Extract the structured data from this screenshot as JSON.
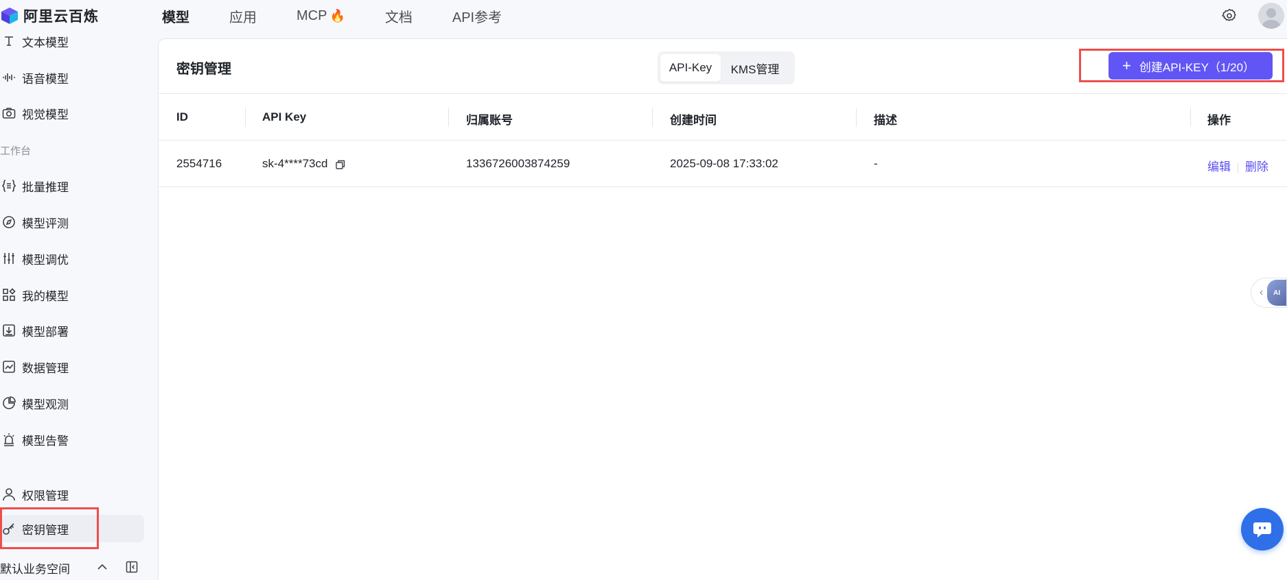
{
  "brand": {
    "name": "阿里云百炼"
  },
  "topnav": {
    "items": [
      {
        "label": "模型",
        "active": true
      },
      {
        "label": "应用"
      },
      {
        "label": "MCP",
        "icon": "fire-icon"
      },
      {
        "label": "文档"
      },
      {
        "label": "API参考"
      }
    ]
  },
  "sidebar": {
    "items_top": [
      {
        "label": "文本模型",
        "icon": "text-model-icon"
      },
      {
        "label": "语音模型",
        "icon": "waveform-icon"
      },
      {
        "label": "视觉模型",
        "icon": "camera-icon"
      }
    ],
    "group_workbench": "工作台",
    "items_workbench": [
      {
        "label": "批量推理",
        "icon": "batch-icon"
      },
      {
        "label": "模型评测",
        "icon": "compass-icon"
      },
      {
        "label": "模型调优",
        "icon": "sliders-icon"
      },
      {
        "label": "我的模型",
        "icon": "grid-icon"
      },
      {
        "label": "模型部署",
        "icon": "deploy-icon"
      },
      {
        "label": "数据管理",
        "icon": "chart-icon"
      },
      {
        "label": "模型观测",
        "icon": "pie-icon"
      },
      {
        "label": "模型告警",
        "icon": "alarm-icon"
      }
    ],
    "items_bottom": [
      {
        "label": "权限管理",
        "icon": "user-icon"
      },
      {
        "label": "密钥管理",
        "icon": "key-icon",
        "selected": true
      }
    ],
    "workspace": "默认业务空间"
  },
  "main": {
    "title": "密钥管理",
    "tabs": [
      {
        "label": "API-Key",
        "active": true
      },
      {
        "label": "KMS管理"
      }
    ],
    "create_button": "创建API-KEY（1/20）",
    "table": {
      "columns": [
        "ID",
        "API Key",
        "归属账号",
        "创建时间",
        "描述",
        "操作"
      ],
      "rows": [
        {
          "id": "2554716",
          "api_key": "sk-4****73cd",
          "account": "1336726003874259",
          "created": "2025-09-08 17:33:02",
          "desc": "-",
          "actions": [
            "编辑",
            "删除"
          ]
        }
      ]
    }
  },
  "floating": {
    "ai_badge": "AI"
  },
  "colors": {
    "accent": "#6155f5",
    "link": "#5b4ff0",
    "highlight": "#ee4d4d",
    "help": "#2f6fe8"
  }
}
